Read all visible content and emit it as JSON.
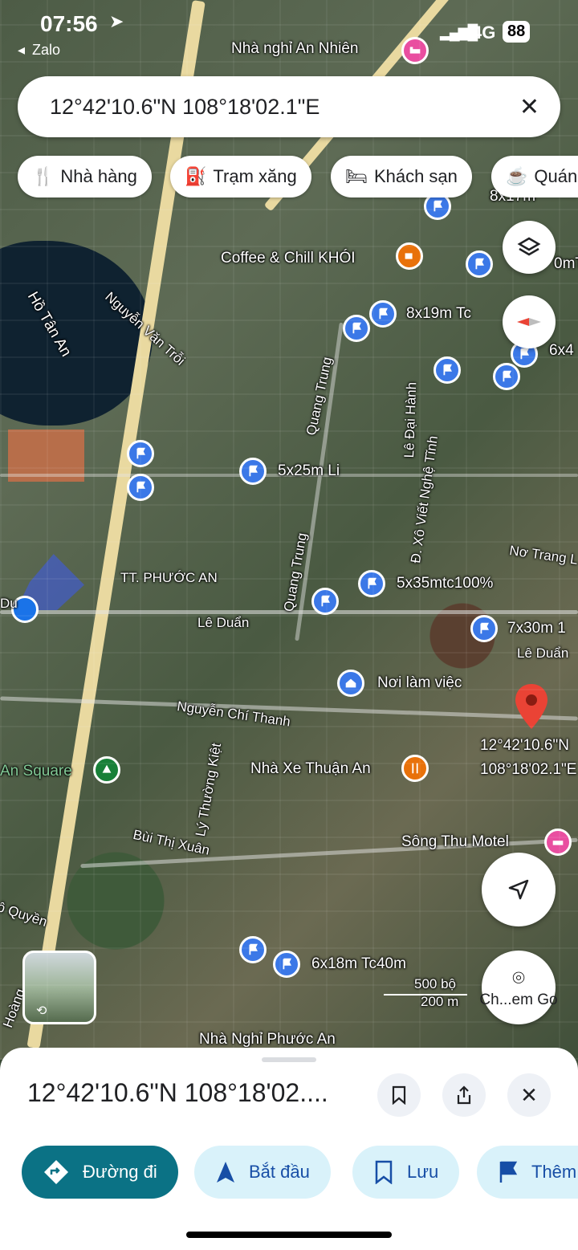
{
  "status": {
    "time": "07:56",
    "back_app": "Zalo",
    "network": "4G",
    "battery": "88"
  },
  "search": {
    "value": "12°42'10.6\"N 108°18'02.1\"E"
  },
  "chips": [
    {
      "label": "Nhà hàng",
      "icon": "restaurant-icon"
    },
    {
      "label": "Trạm xăng",
      "icon": "gas-station-icon"
    },
    {
      "label": "Khách sạn",
      "icon": "hotel-icon"
    },
    {
      "label": "Quán",
      "icon": "cafe-icon"
    }
  ],
  "map": {
    "places": {
      "nha_nghi_an_nhien": "Nhà nghỉ An Nhiên",
      "coffee": "Coffee & Chill KHÓI",
      "ho_tan_an": "Hồ Tân An",
      "tt_phuoc_an": "TT. PHƯỚC AN",
      "noi_lam_viec": "Nơi làm việc",
      "nha_xe": "Nhà Xe Thuận An",
      "an_square": "An Square",
      "song_thu": "Sông Thu Motel",
      "nha_nghi_phuoc_an": "Nhà Nghỉ Phước An",
      "pin_coords_1": "12°42'10.6\"N",
      "pin_coords_2": "108°18'02.1\"E"
    },
    "streets": {
      "nguyen_van_troi": "Nguyễn Văn Trỗi",
      "quang_trung_1": "Quang Trung",
      "quang_trung_2": "Quang Trung",
      "le_dai_hanh": "Lê Đại Hành",
      "xo_viet": "Đ. Xô Viết Nghệ Tĩnh",
      "no_trang": "Nơ Trang L",
      "le_duan_1": "Lê Duẩn",
      "le_duan_2": "Lê Duẩn",
      "nguyen_chi_thanh": "Nguyễn Chí Thanh",
      "ly_thuong_kiet": "Lý Thường Kiệt",
      "bui_thi_xuan": "Bùi Thị Xuân",
      "ngo_quyen": "ô Quyền",
      "hoang": "Hoàng",
      "du": "Du"
    },
    "listing_labels": {
      "l1": "8x17m",
      "l2": "0mT",
      "l3": "8x19m Tc",
      "l4": "6x4",
      "l5": "5x25m Li",
      "l6": "5x35mtc100%",
      "l7": "7x30m 1",
      "l8": "6x18m Tc40m"
    },
    "scale": {
      "feet": "500 bộ",
      "meters": "200 m"
    },
    "photo_search_label": "Ch...em Go"
  },
  "sheet": {
    "title": "12°42'10.6\"N 108°18'02....",
    "actions": [
      {
        "label": "Đường đi",
        "icon": "directions-icon"
      },
      {
        "label": "Bắt đầu",
        "icon": "navigation-arrow-icon"
      },
      {
        "label": "Lưu",
        "icon": "bookmark-icon"
      },
      {
        "label": "Thêm",
        "icon": "flag-icon"
      }
    ]
  },
  "colors": {
    "accent": "#0b7285",
    "pin_blue": "#3b78e7",
    "pin_red": "#ea4335",
    "chip_bg": "#d9f2fa"
  }
}
